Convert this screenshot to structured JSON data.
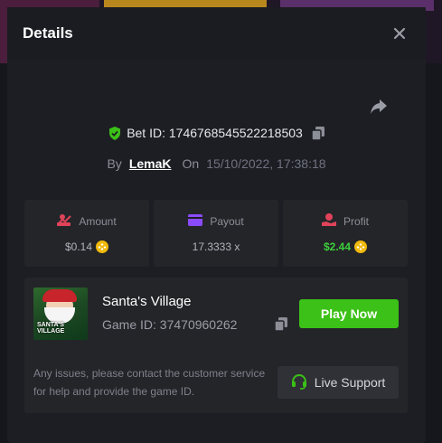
{
  "modal": {
    "title": "Details"
  },
  "bet": {
    "label": "Bet ID: 1746768545522218503",
    "by_label": "By",
    "user": "LemaK",
    "on_label": "On",
    "date": "15/10/2022, 17:38:18"
  },
  "stats": {
    "amount": {
      "label": "Amount",
      "value": "$0.14"
    },
    "payout": {
      "label": "Payout",
      "value": "17.3333 x"
    },
    "profit": {
      "label": "Profit",
      "value": "$2.44"
    }
  },
  "game": {
    "name": "Santa's Village",
    "id_text": "Game ID: 37470960262",
    "thumb_text": "SANTA'S VILLAGE",
    "play_label": "Play Now"
  },
  "support": {
    "notice": "Any issues, please contact the customer service for help and provide the game ID.",
    "button_label": "Live Support"
  },
  "colors": {
    "accent_green": "#3bc117",
    "profit_green": "#3ccf3c",
    "coin": "#f0b90b",
    "amount_icon": "#e0435a",
    "payout_icon": "#8a4bff",
    "profit_icon": "#e0435a"
  },
  "icons": [
    "close-icon",
    "share-icon",
    "shield-check-icon",
    "copy-icon",
    "amount-icon",
    "wallet-icon",
    "profit-icon",
    "coin-icon",
    "headset-icon"
  ]
}
